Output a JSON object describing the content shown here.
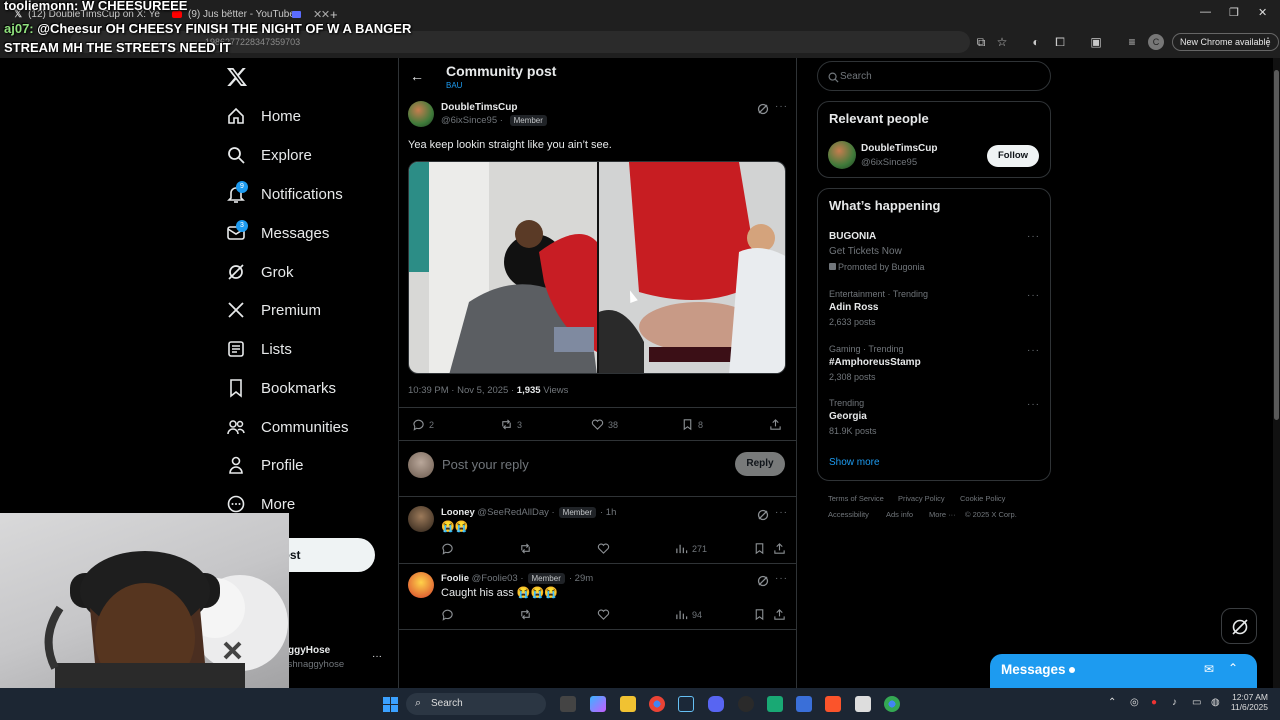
{
  "browser": {
    "tabs": [
      {
        "label": "(12) DoubleTimsCup on X: Ye"
      },
      {
        "label": "(9) Jus bëtter - YouTube"
      }
    ],
    "url": "1986277228347359703",
    "new_chrome": "New Chrome available"
  },
  "chat": [
    {
      "user": "tooliemonn:",
      "text": "W CHEESUREEE"
    },
    {
      "user": "aj07:",
      "text": "@Cheesur OH CHEESY FINISH THE NIGHT OF W A BANGER"
    },
    {
      "user": "",
      "text": "STREAM MH THE STREETS NEED IT"
    }
  ],
  "nav": {
    "items": [
      {
        "label": "Home",
        "icon": "home-icon"
      },
      {
        "label": "Explore",
        "icon": "search-icon"
      },
      {
        "label": "Notifications",
        "icon": "bell-icon",
        "badge": "9"
      },
      {
        "label": "Messages",
        "icon": "envelope-icon",
        "badge": "3"
      },
      {
        "label": "Grok",
        "icon": "grok-icon"
      },
      {
        "label": "Premium",
        "icon": "x-logo-icon"
      },
      {
        "label": "Lists",
        "icon": "list-icon"
      },
      {
        "label": "Bookmarks",
        "icon": "bookmark-icon"
      },
      {
        "label": "Communities",
        "icon": "people-icon"
      },
      {
        "label": "Profile",
        "icon": "person-icon"
      },
      {
        "label": "More",
        "icon": "more-circle-icon"
      }
    ],
    "post_label": "Post",
    "account_name": "ggyHose",
    "account_handle": "tshnaggyhose"
  },
  "header": {
    "title": "Community post",
    "subtitle": "BAU"
  },
  "post": {
    "author": "DoubleTimsCup",
    "handle": "@6ixSince95",
    "member": "Member",
    "text": "Yea keep lookin straight like you ain’t see.",
    "time": "10:39 PM · Nov 5, 2025 ·",
    "views_count": "1,935",
    "views_label": "Views",
    "replies": "2",
    "reposts": "3",
    "likes": "38",
    "bookmarks": "8"
  },
  "reply_box": {
    "placeholder": "Post your reply",
    "button": "Reply"
  },
  "replies": [
    {
      "name": "Looney",
      "handle": "@SeeRedAllDay",
      "member": "Member",
      "time": "· 1h",
      "text": "😭😭",
      "views": "271"
    },
    {
      "name": "Foolie",
      "handle": "@Foolie03",
      "member": "Member",
      "time": "· 29m",
      "text": "Caught his ass 😭😭😭",
      "views": "94"
    }
  ],
  "search": {
    "placeholder": "Search"
  },
  "relevant": {
    "title": "Relevant people",
    "name": "DoubleTimsCup",
    "handle": "@6ixSince95",
    "follow": "Follow"
  },
  "happening": {
    "title": "What’s happening",
    "promo": {
      "name": "BUGONIA",
      "line": "Get Tickets Now",
      "promoted": "Promoted by Bugonia"
    },
    "trends": [
      {
        "meta": "Entertainment · Trending",
        "name": "Adin Ross",
        "posts": "2,633 posts"
      },
      {
        "meta": "Gaming · Trending",
        "name": "#AmphoreusStamp",
        "posts": "2,308 posts"
      },
      {
        "meta": "Trending",
        "name": "Georgia",
        "posts": "81.9K posts"
      }
    ],
    "show_more": "Show more"
  },
  "footer": {
    "links": [
      "Terms of Service",
      "Privacy Policy",
      "Cookie Policy",
      "Accessibility",
      "Ads info",
      "More ···",
      "© 2025 X Corp."
    ]
  },
  "messages_drawer": {
    "label": "Messages"
  },
  "taskbar": {
    "search": "Search",
    "time": "12:07 AM",
    "date": "11/6/2025"
  },
  "colors": {
    "accent": "#1d9bf0",
    "background": "#000000",
    "border": "#2f3336",
    "muted": "#71767b"
  }
}
